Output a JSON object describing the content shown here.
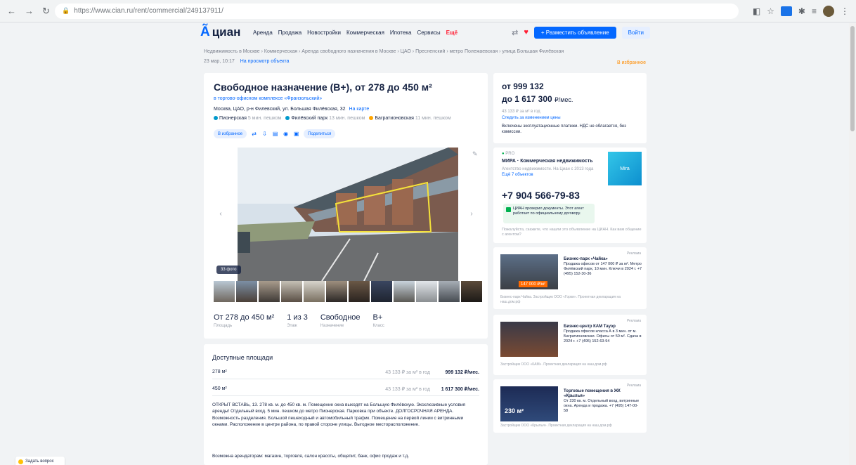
{
  "browser": {
    "url": "https://www.cian.ru/rent/commercial/249137911/",
    "nav_back": "←",
    "nav_forward": "→",
    "nav_reload": "↻"
  },
  "header": {
    "logo_text": "циан",
    "nav_items": [
      "Аренда",
      "Продажа",
      "Новостройки",
      "Коммерческая",
      "Ипотека",
      "Сервисы",
      "Ещё"
    ],
    "place_ad_label": "+ Разместить объявление",
    "login_label": "Войти"
  },
  "breadcrumbs": "Недвижимость в Москве  ›  Коммерческая  ›  Аренда свободного назначения в Москве  ›  ЦАО  ›  Пресненский  ›  метро Полежаевская  ›  улица Большая Филёвская",
  "meta": {
    "date": "23 мар, 10:17",
    "stats": "На просмотр объекта",
    "favorite": "В избранное"
  },
  "listing": {
    "title": "Свободное назначение (B+), от 278 до 450 м²",
    "subtitle": "в торгово-офисном комплексе «Франзольский»",
    "address": "Москва, ЦАО, р-н Филевский, ул. Большая Филёвская, 32",
    "map_link": "На карте",
    "metro": [
      {
        "name": "Пионерская",
        "time": "5 мин. пешком",
        "color": "#0099cc"
      },
      {
        "name": "Филёвский парк",
        "time": "13 мин. пешком",
        "color": "#0099cc"
      },
      {
        "name": "Багратионовская",
        "time": "11 мин. пешком",
        "color": "#ffa500"
      }
    ],
    "actions": [
      "В избранное",
      "Поделиться"
    ],
    "photo_count": "33 фото",
    "facts": [
      {
        "value": "От 278 до 450 м²",
        "label": "Площадь"
      },
      {
        "value": "1 из 3",
        "label": "Этаж"
      },
      {
        "value": "Свободное",
        "label": "Назначение"
      },
      {
        "value": "B+",
        "label": "Класс"
      }
    ]
  },
  "areas": {
    "title": "Доступные площади",
    "rows": [
      {
        "area": "278 м²",
        "per_m": "43 133 ₽ за м² в год",
        "price": "999 132 ₽/мес."
      },
      {
        "area": "450 м²",
        "per_m": "43 133 ₽ за м² в год",
        "price": "1 617 300 ₽/мес."
      }
    ],
    "description": "ОТКРЫТ ВСТАВЬ, 13. 278 кв. м. до 450 кв. м. Помещение окна выходят на Большую Филёвскую. Эксклюзивные условия аренды! Отдельный вход. 5 мин. пешком до метро Пионерская. Парковка при объекте. ДОЛГОСРОЧНАЯ АРЕНДА. Возможность разделения. Большой пешеходный и автомобильный трафик. Помещение на первой линии с витринными окнами. Расположение в центре района, по правой стороне улицы. Выгодное месторасположение.",
    "description2": "Возможна арендаторам: магазин, торговля, салон красоты, общепит, банк, офис продаж и т.д."
  },
  "price": {
    "from": "от 999 132",
    "to": "до 1 617 300",
    "unit": "₽/мес.",
    "per_m": "43 133 ₽ за м² в год",
    "mortgage_link": "Следить за изменением цены",
    "note": "Включены эксплуатационные платежи. НДС не облагается, без комиссии."
  },
  "agent": {
    "pro_label": "PRO",
    "name": "МИРА · Коммерческая недвижимость",
    "info": "Агентство недвижимости. На Циан с 2013 года",
    "objects_link": "Ещё 7 объектов",
    "logo_text": "Mira",
    "phone": "+7 904 566-79-83",
    "verified": "ЦИАН проверил документы. Этот агент работает по официальному договору.",
    "foot": "Пожалуйста, скажите, что нашли это объявление на ЦИАН. Как вам общение с агентом?"
  },
  "ads": [
    {
      "label": "Реклама",
      "title": "Бизнес-парк «Чайка»",
      "text": "Продажа офисов от 147 000 ₽ за м². Метро Филёвский парк, 10 мин. Ключи в 2024 г. +7 (495) 152-30-36",
      "badge": "147 000 ₽/м²",
      "foot": "Бизнес-парк Чайка. Застройщик ООО «Горки». Проектная декларация на наш.дом.рф"
    },
    {
      "label": "Реклама",
      "title": "Бизнес-центр КАМ Тауэр",
      "text": "Продажа офисов класса А в 3 мин. от м. Багратионовская. Офисы от 50 м². Сдача в 2024 г. +7 (495) 152-63-94",
      "badge": "",
      "foot": "Застройщик ООО «КАМ». Проектная декларация на наш.дом.рф"
    },
    {
      "label": "Реклама",
      "title": "Торговые помещения в ЖК «Крылья»",
      "text": "От 230 кв. м. Отдельный вход, витринные окна. Аренда и продажа. +7 (495) 147-00-58",
      "badge": "230 м²",
      "foot": "Застройщик ООО «Крылья». Проектная декларация на наш.дом.рф"
    }
  ],
  "chat_button": "Задать вопрос"
}
